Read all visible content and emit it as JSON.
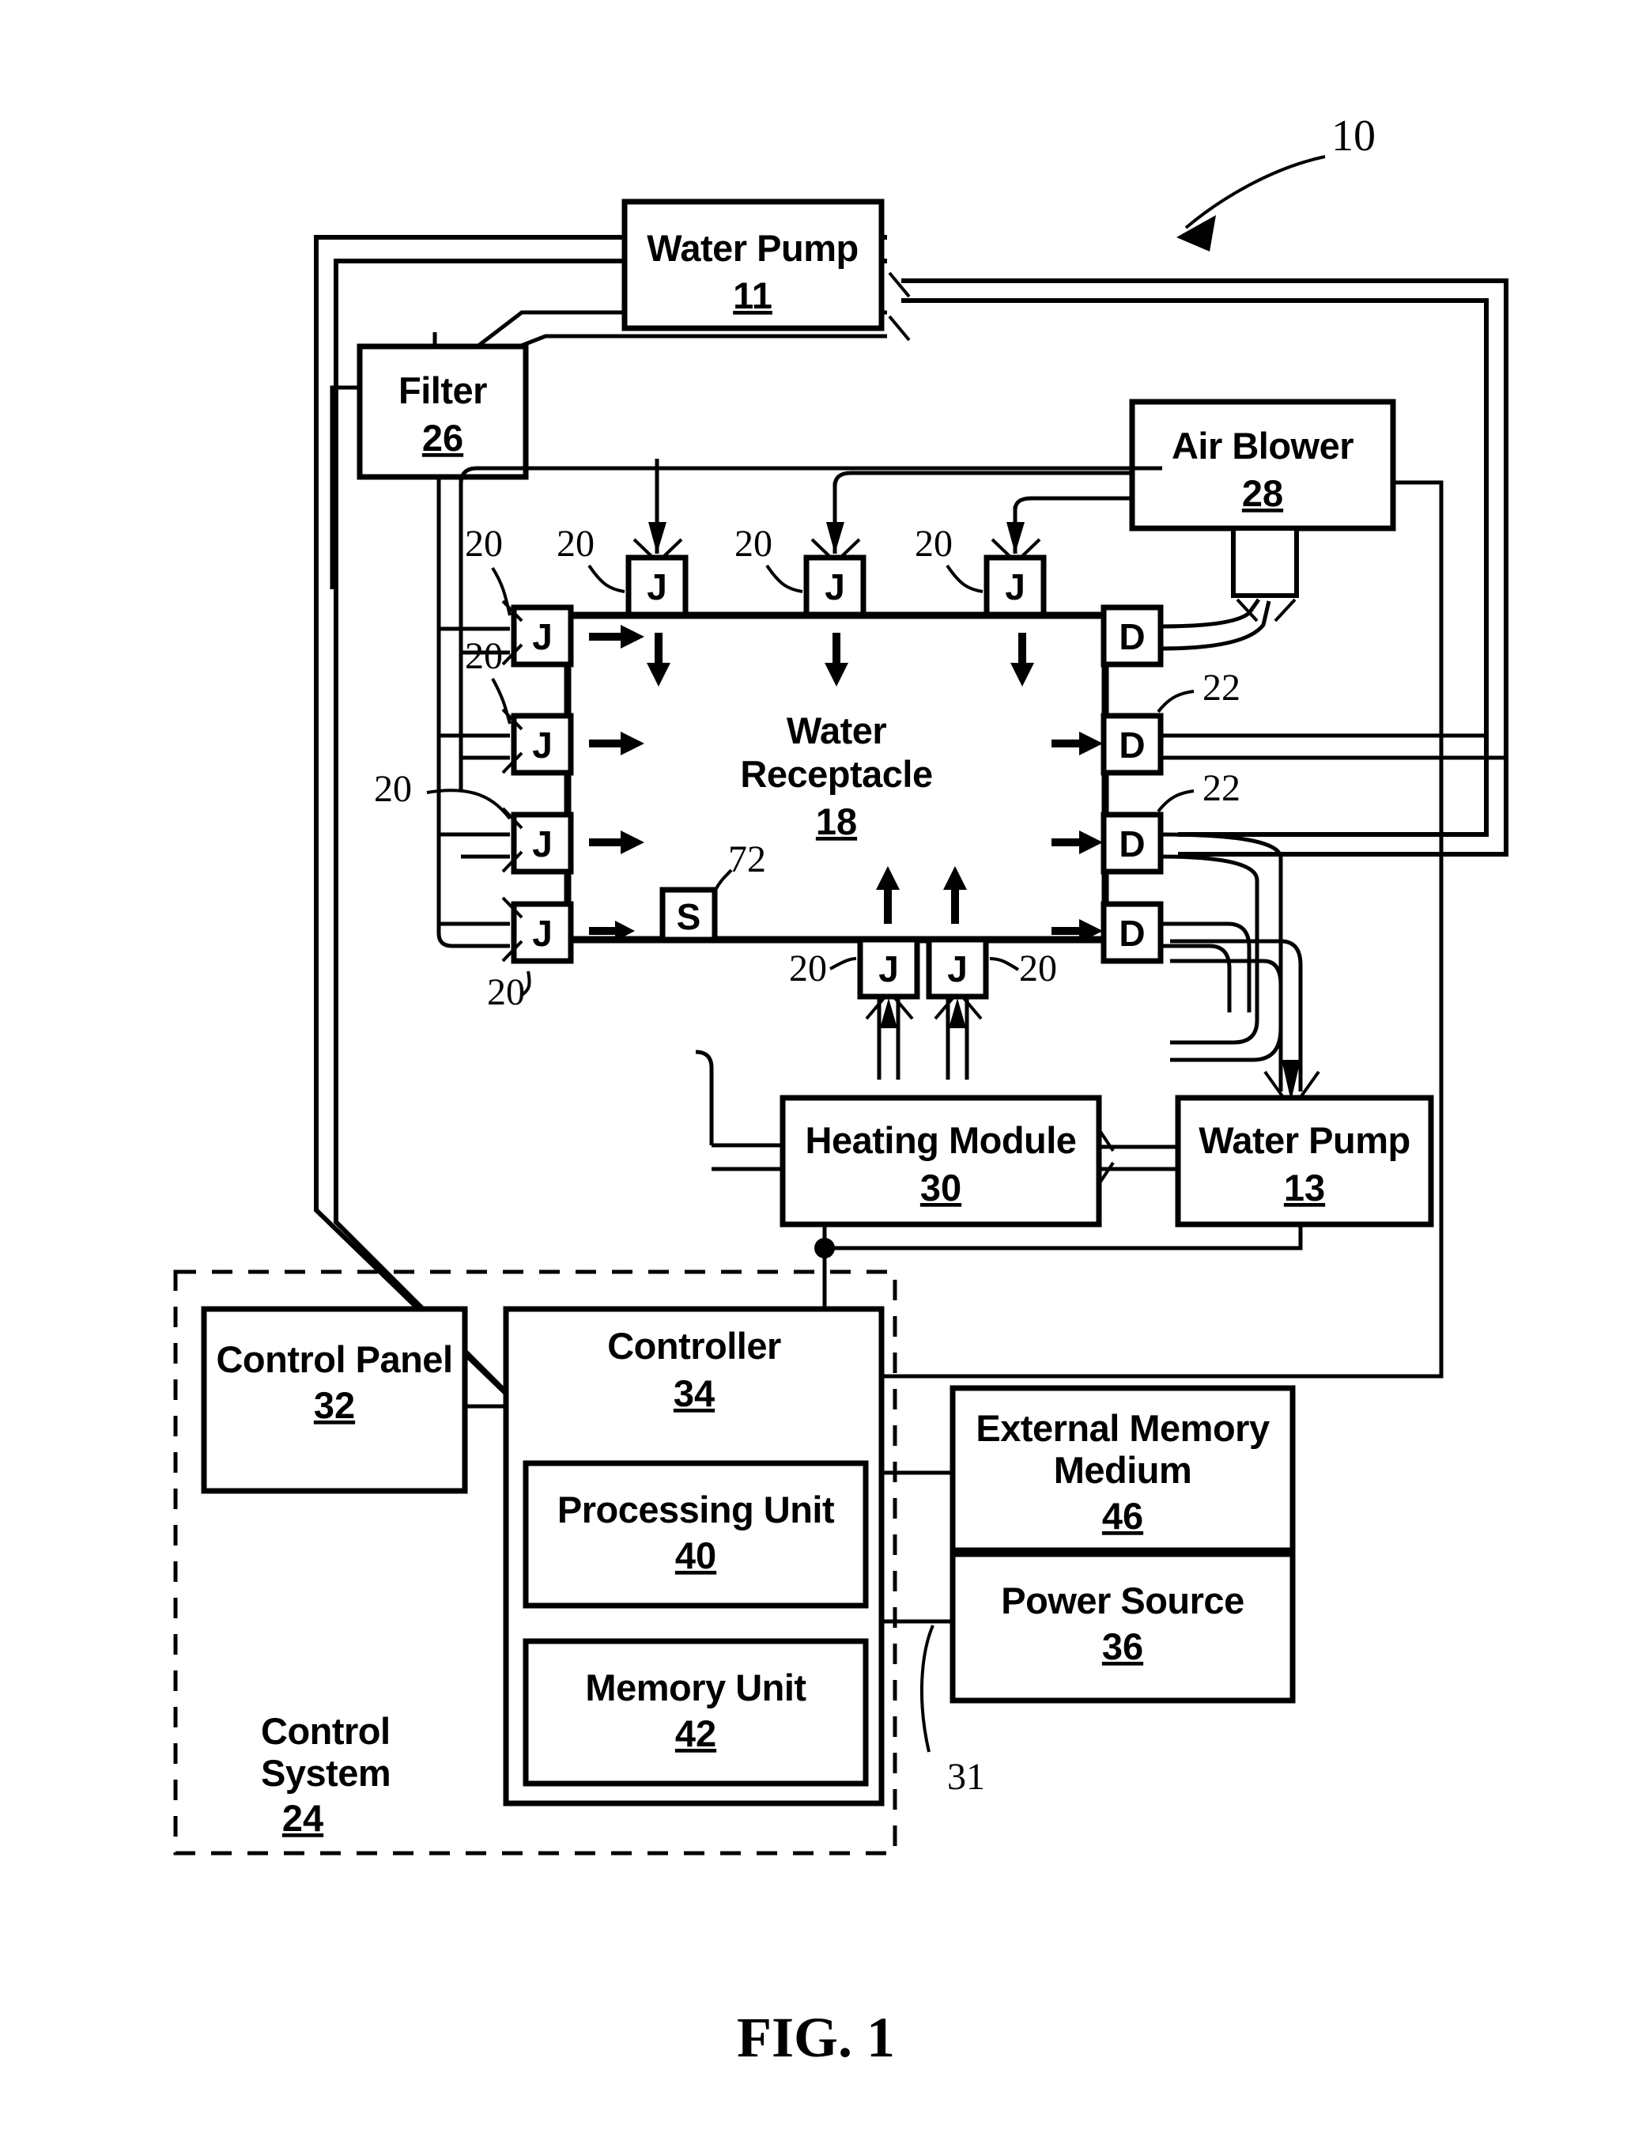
{
  "figure": {
    "caption": "FIG. 1",
    "system_ref": "10"
  },
  "blocks": {
    "water_pump_11": {
      "title": "Water Pump",
      "ref": "11"
    },
    "filter_26": {
      "title": "Filter",
      "ref": "26"
    },
    "air_blower_28": {
      "title": "Air Blower",
      "ref": "28"
    },
    "water_receptacle_18": {
      "title_line1": "Water",
      "title_line2": "Receptacle",
      "ref": "18"
    },
    "heating_module_30": {
      "title": "Heating Module",
      "ref": "30"
    },
    "water_pump_13": {
      "title": "Water Pump",
      "ref": "13"
    },
    "control_panel_32": {
      "title": "Control Panel",
      "ref": "32"
    },
    "controller_34": {
      "title": "Controller",
      "ref": "34"
    },
    "processing_unit_40": {
      "title": "Processing Unit",
      "ref": "40"
    },
    "memory_unit_42": {
      "title": "Memory Unit",
      "ref": "42"
    },
    "external_memory_46": {
      "title_line1": "External Memory",
      "title_line2": "Medium",
      "ref": "46"
    },
    "power_source_36": {
      "title": "Power Source",
      "ref": "36"
    },
    "control_system_24": {
      "title_line1": "Control",
      "title_line2": "System",
      "ref": "24"
    }
  },
  "small_boxes": {
    "jet_letter": "J",
    "drain_letter": "D",
    "sensor_letter": "S"
  },
  "callouts": {
    "jet_ref": "20",
    "drain_ref": "22",
    "sensor_ref": "72",
    "bus_ref": "31",
    "system_ref": "10"
  },
  "jets_top": [
    {
      "ref": "20"
    },
    {
      "ref": "20"
    },
    {
      "ref": "20"
    }
  ],
  "jets_left": [
    {
      "ref": "20"
    },
    {
      "ref": "20"
    },
    {
      "ref": "20"
    },
    {
      "ref": "20"
    }
  ],
  "jets_bottom": [
    {
      "ref": "20"
    },
    {
      "ref": "20"
    }
  ],
  "drains_right": [
    {
      "letter": "D",
      "ref": ""
    },
    {
      "letter": "D",
      "ref": "22"
    },
    {
      "letter": "D",
      "ref": "22"
    },
    {
      "letter": "D",
      "ref": ""
    }
  ]
}
